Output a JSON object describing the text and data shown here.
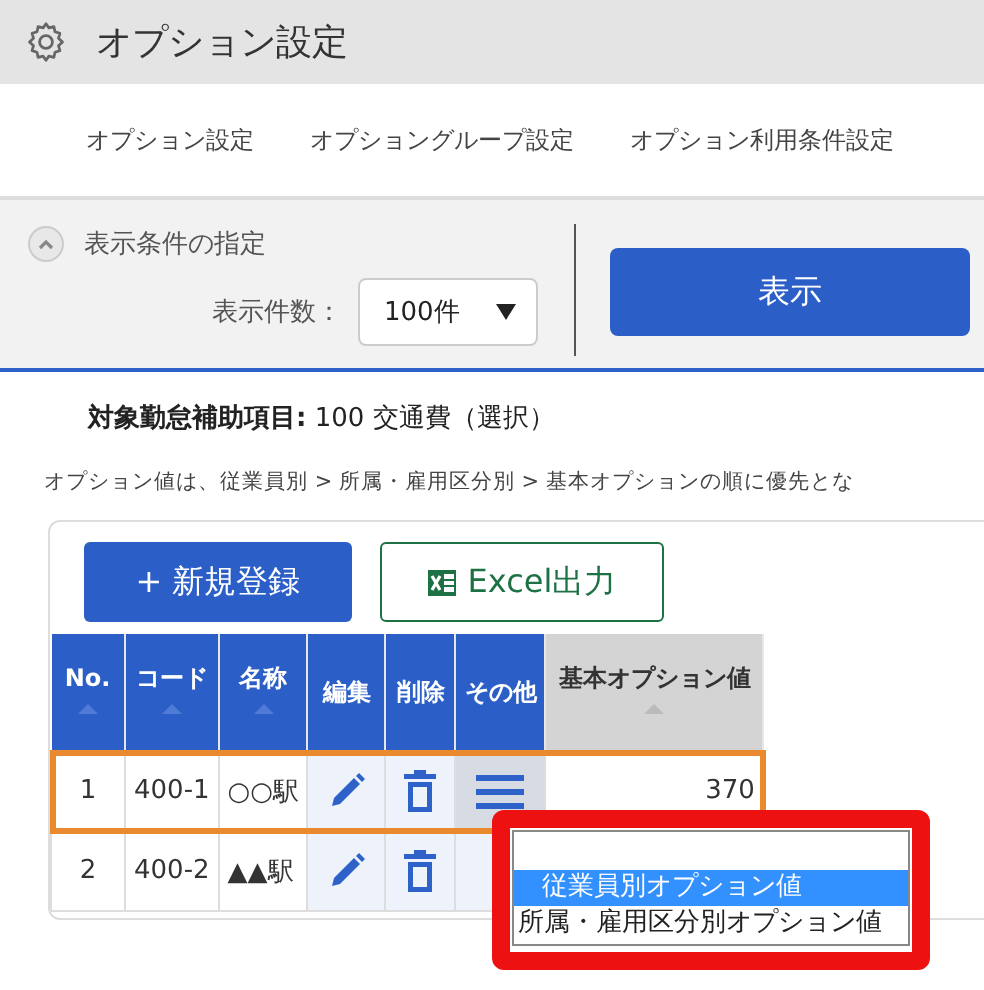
{
  "header": {
    "title": "オプション設定"
  },
  "tabs": [
    {
      "label": "オプション設定",
      "selected": false
    },
    {
      "label": "オプショングループ設定",
      "selected": false
    },
    {
      "label": "オプション利用条件設定",
      "selected": false
    }
  ],
  "filter": {
    "title": "表示条件の指定",
    "expanded": true,
    "count_label": "表示件数：",
    "count_value": "100件",
    "submit": "表示"
  },
  "target": {
    "label": "対象勤怠補助項目:",
    "value": "100 交通費（選択）"
  },
  "note": "オプション値は、従業員別 > 所属・雇用区分別 > 基本オプションの順に優先とな",
  "buttons": {
    "add": "+ 新規登録",
    "excel": "Excel出力"
  },
  "table": {
    "columns": [
      {
        "label": "No.",
        "sortable": true,
        "kind": "blue"
      },
      {
        "label": "コード",
        "sortable": true,
        "kind": "blue"
      },
      {
        "label": "名称",
        "sortable": true,
        "kind": "blue"
      },
      {
        "label": "編集",
        "sortable": false,
        "kind": "blue"
      },
      {
        "label": "削除",
        "sortable": false,
        "kind": "blue"
      },
      {
        "label": "その他",
        "sortable": false,
        "kind": "blue"
      },
      {
        "label": "基本オプション値",
        "sortable": true,
        "kind": "gray"
      }
    ],
    "rows": [
      {
        "no": "1",
        "code": "400-1",
        "name": "○○駅",
        "value": "370",
        "selected": true,
        "menu_shown": true
      },
      {
        "no": "2",
        "code": "400-2",
        "name": "▲▲駅",
        "selected": false,
        "menu_shown": false
      }
    ]
  },
  "menu": {
    "options": [
      {
        "label": "従業員別オプション値",
        "selected": true
      },
      {
        "label": "所属・雇用区分別オプション値",
        "selected": false
      }
    ]
  }
}
